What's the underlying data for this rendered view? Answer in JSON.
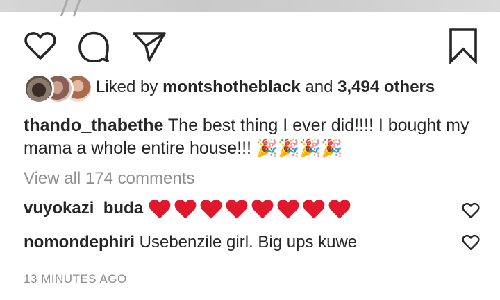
{
  "post": {
    "liked_by_prefix": "Liked by ",
    "liked_by_user": "montshotheblack",
    "and_text": " and ",
    "others_count": "3,494 others"
  },
  "caption": {
    "username": "thando_thabethe",
    "text": " The best thing I ever did!!!! I bought my mama a whole entire house!!! ",
    "emoji": "🎉🎉🎉🎉"
  },
  "comments_link": "View all 174 comments",
  "comments": [
    {
      "username": "vuyokazi_buda",
      "text": "",
      "heart_count": 8
    },
    {
      "username": "nomondephiri",
      "text": " Usebenzile girl. Big ups kuwe"
    }
  ],
  "timestamp": "13 MINUTES AGO",
  "icons": [
    "heart-icon",
    "comment-icon",
    "share-icon",
    "bookmark-icon"
  ],
  "colors": {
    "text": "#262626",
    "muted": "#8e8e8e",
    "heart_red": "#e0182d"
  }
}
